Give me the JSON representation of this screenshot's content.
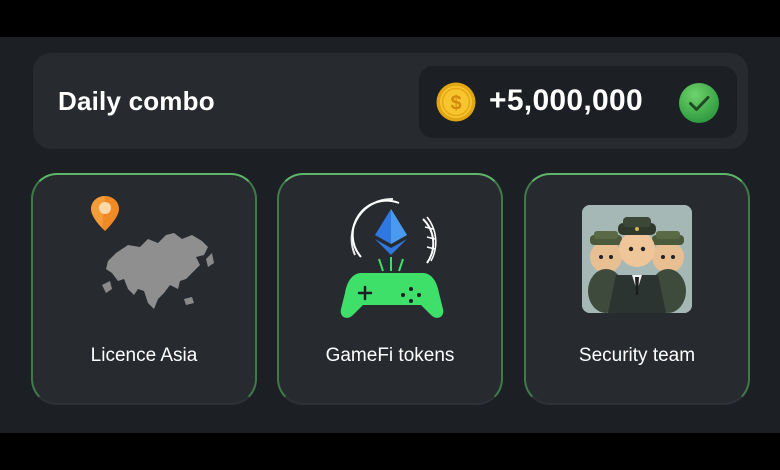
{
  "combo": {
    "title": "Daily combo",
    "reward": "+5,000,000",
    "coin_icon": "gold-dollar-coin-icon",
    "status_icon": "green-checkmark-icon"
  },
  "cards": [
    {
      "label": "Licence Asia",
      "icon": "asia-map-with-pin"
    },
    {
      "label": "GameFi tokens",
      "icon": "ethereum-gamepad"
    },
    {
      "label": "Security team",
      "icon": "hamster-security-guards-image"
    }
  ],
  "colors": {
    "background": "#1c1f24",
    "panel": "#272a2f",
    "card_border_accent": "#5fb56a",
    "gamepad_green": "#3ee06a",
    "coin_gold": "#f5c42c",
    "check_green": "#3fb34f",
    "pin_orange": "#f08a24"
  }
}
